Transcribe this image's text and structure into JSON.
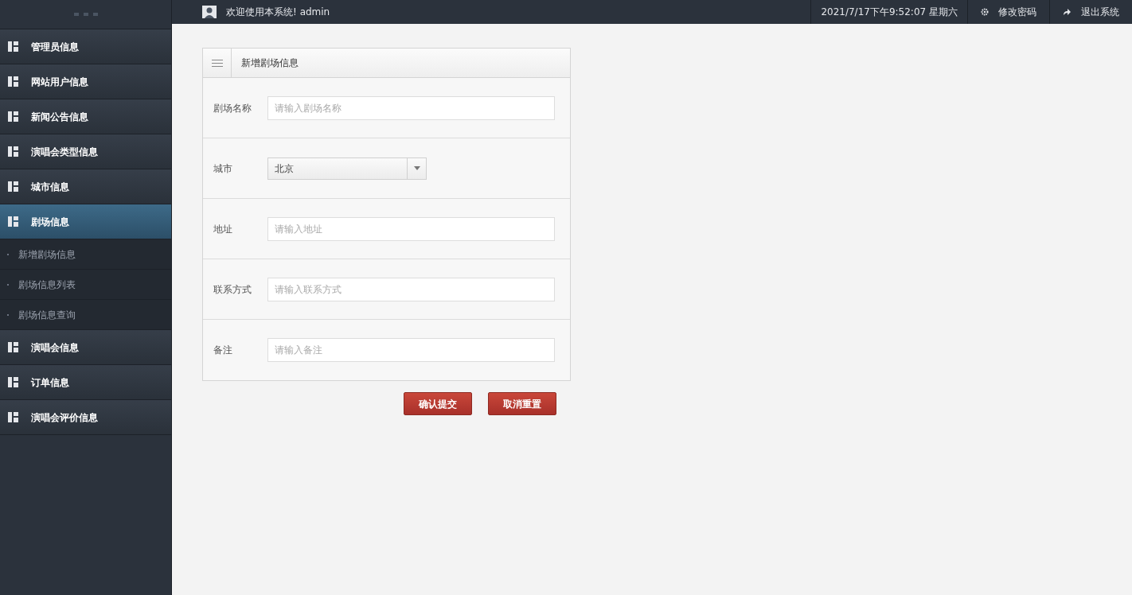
{
  "topbar": {
    "welcome": "欢迎使用本系统! admin",
    "datetime": "2021/7/17下午9:52:07 星期六",
    "actions": [
      {
        "kind": "settings",
        "label": "修改密码"
      },
      {
        "kind": "logout",
        "label": "退出系统"
      }
    ]
  },
  "sidebar": {
    "items": [
      {
        "label": "管理员信息",
        "selected": false
      },
      {
        "label": "网站用户信息",
        "selected": false
      },
      {
        "label": "新闻公告信息",
        "selected": false
      },
      {
        "label": "演唱会类型信息",
        "selected": false
      },
      {
        "label": "城市信息",
        "selected": false
      },
      {
        "label": "剧场信息",
        "selected": true,
        "children": [
          {
            "label": "新增剧场信息",
            "selected": false
          },
          {
            "label": "剧场信息列表",
            "selected": false
          },
          {
            "label": "剧场信息查询",
            "selected": false
          }
        ]
      },
      {
        "label": "演唱会信息",
        "selected": false
      },
      {
        "label": "订单信息",
        "selected": false
      },
      {
        "label": "演唱会评价信息",
        "selected": false
      }
    ]
  },
  "form": {
    "title": "新增剧场信息",
    "fields": [
      {
        "kind": "input",
        "label": "剧场名称",
        "placeholder": "请输入剧场名称"
      },
      {
        "kind": "select",
        "label": "城市",
        "value": "北京"
      },
      {
        "kind": "input",
        "label": "地址",
        "placeholder": "请输入地址"
      },
      {
        "kind": "input",
        "label": "联系方式",
        "placeholder": "请输入联系方式"
      },
      {
        "kind": "input",
        "label": "备注",
        "placeholder": "请输入备注"
      }
    ],
    "buttons": [
      "确认提交",
      "取消重置"
    ]
  }
}
